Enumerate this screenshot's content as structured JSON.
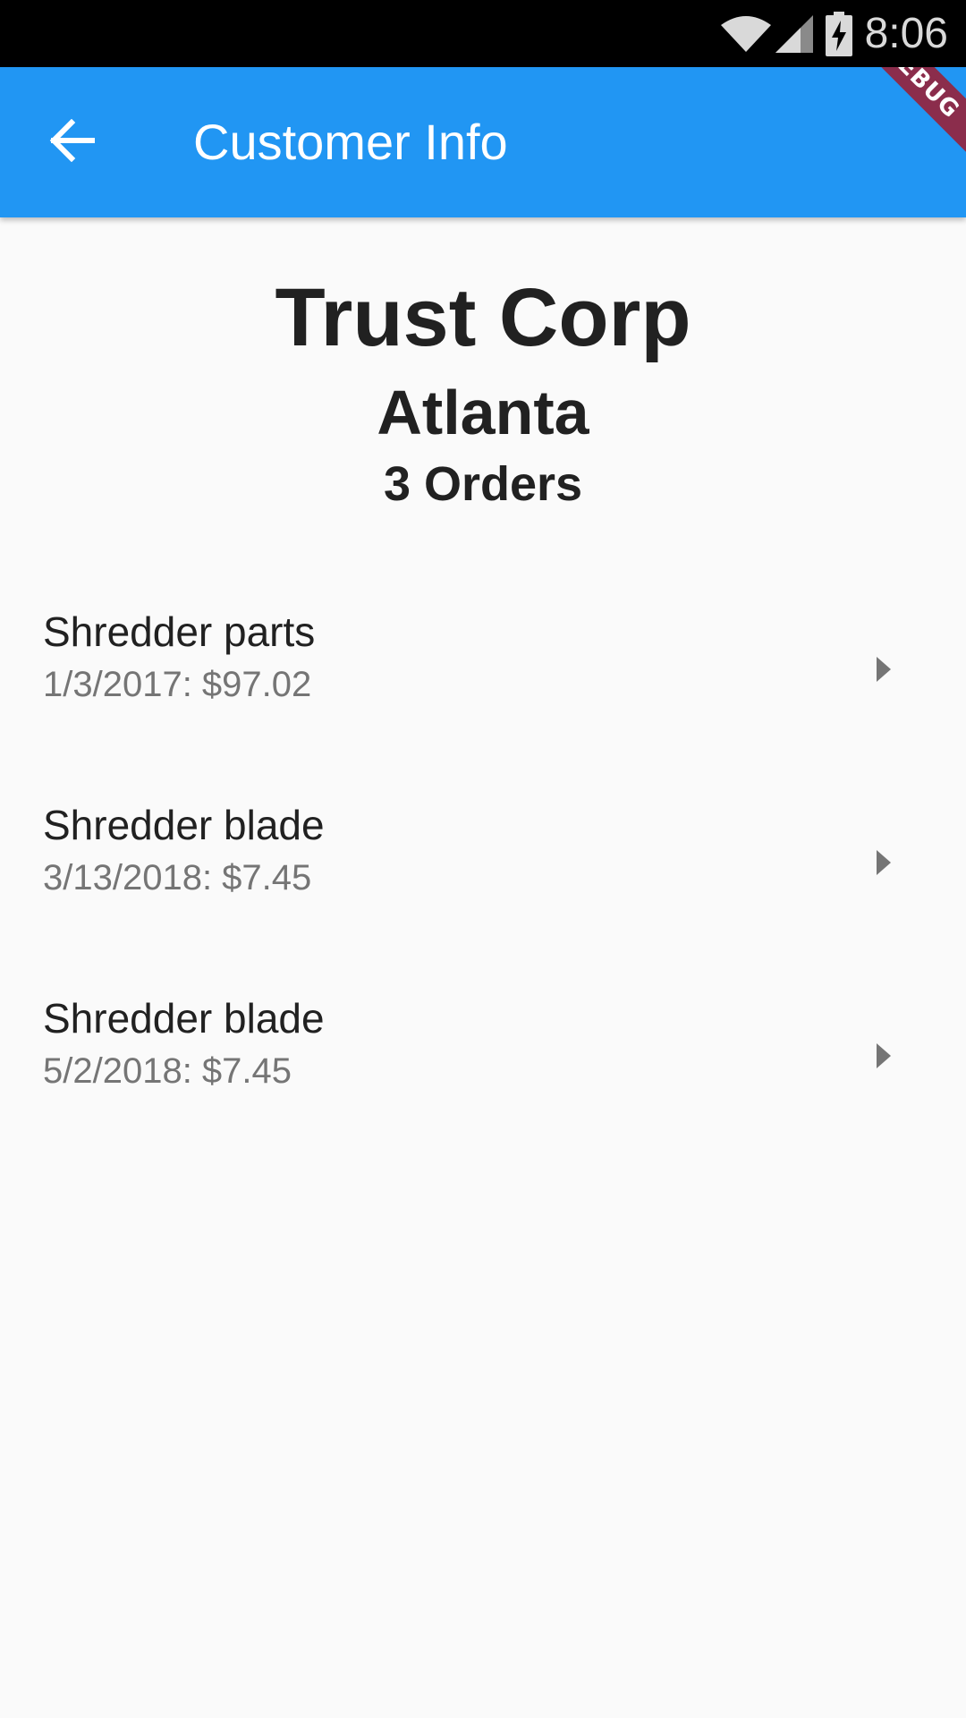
{
  "status_bar": {
    "time": "8:06",
    "icons": [
      "wifi-icon",
      "cell-signal-icon",
      "battery-charging-icon"
    ]
  },
  "app_bar": {
    "title": "Customer Info",
    "back_icon": "arrow-back-icon",
    "background_color": "#2196f3",
    "debug_banner_text": "DEBUG"
  },
  "customer": {
    "name": "Trust Corp",
    "city": "Atlanta",
    "order_count_label": "3 Orders"
  },
  "orders": [
    {
      "title": "Shredder parts",
      "subtitle": "1/3/2017: $97.02"
    },
    {
      "title": "Shredder blade",
      "subtitle": "3/13/2018: $7.45"
    },
    {
      "title": "Shredder blade",
      "subtitle": "5/2/2018: $7.45"
    }
  ],
  "colors": {
    "primary": "#2196f3",
    "text_primary": "#212121",
    "text_secondary": "#757575",
    "background": "#fafafa"
  }
}
